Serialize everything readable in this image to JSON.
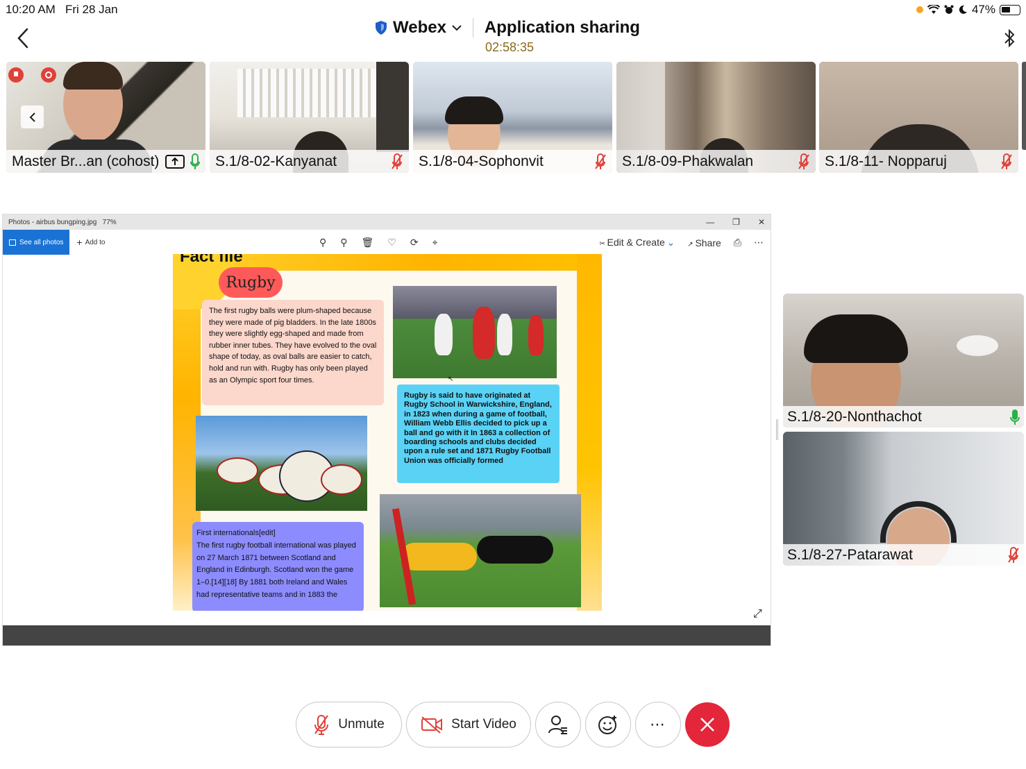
{
  "status_bar": {
    "time": "10:20 AM",
    "date": "Fri 28 Jan",
    "battery": "47%"
  },
  "header": {
    "app_name": "Webex",
    "title": "Application sharing",
    "timer": "02:58:35"
  },
  "participants": [
    {
      "name": "Master Br...an (cohost)",
      "mic": "on"
    },
    {
      "name": "S.1/8-02-Kanyanat",
      "mic": "muted"
    },
    {
      "name": "S.1/8-04-Sophonvit",
      "mic": "muted"
    },
    {
      "name": "S.1/8-09-Phakwalan",
      "mic": "muted"
    },
    {
      "name": "S.1/8-11- Nopparuj",
      "mic": "muted"
    }
  ],
  "side_participants": [
    {
      "name": "S.1/8-20-Nonthachot",
      "mic": "on"
    },
    {
      "name": "S.1/8-27-Patarawat",
      "mic": "muted"
    }
  ],
  "shared_window": {
    "title": "Photos - airbus bungping.jpg",
    "zoom": "77%",
    "see_all_photos": "See all photos",
    "add_to": "Add to",
    "edit_create": "Edit & Create",
    "share": "Share",
    "poster": {
      "heading": "Fact file",
      "title": "Rugby",
      "fact1": "The first rugby balls were plum-shaped because they were made of pig bladders. In the late 1800s they were slightly egg-shaped and made from rubber inner tubes. They have evolved to the oval shape of today, as oval balls are easier to catch, hold and run with. Rugby has only been played as an Olympic sport four times.",
      "fact2": "Rugby is said to have originated at Rugby School in Warwickshire, England, in 1823 when during a game of football, William Webb Ellis decided to pick up a ball and go with it In 1863 a collection of boarding schools and clubs decided upon a rule set and 1871 Rugby Football Union was officially formed",
      "fact3_heading": "First internationals[edit]",
      "fact3": "The first rugby football international was played on 27 March 1871 between Scotland and England in Edinburgh. Scotland won the game 1–0.[14][18] By 1881 both Ireland and Wales had representative teams and in 1883 the"
    }
  },
  "controls": {
    "unmute": "Unmute",
    "start_video": "Start Video"
  },
  "colors": {
    "end_call": "#e3263a",
    "accent_blue": "#1a73d4",
    "mic_on": "#2ab04a",
    "mic_off": "#e0413a"
  }
}
